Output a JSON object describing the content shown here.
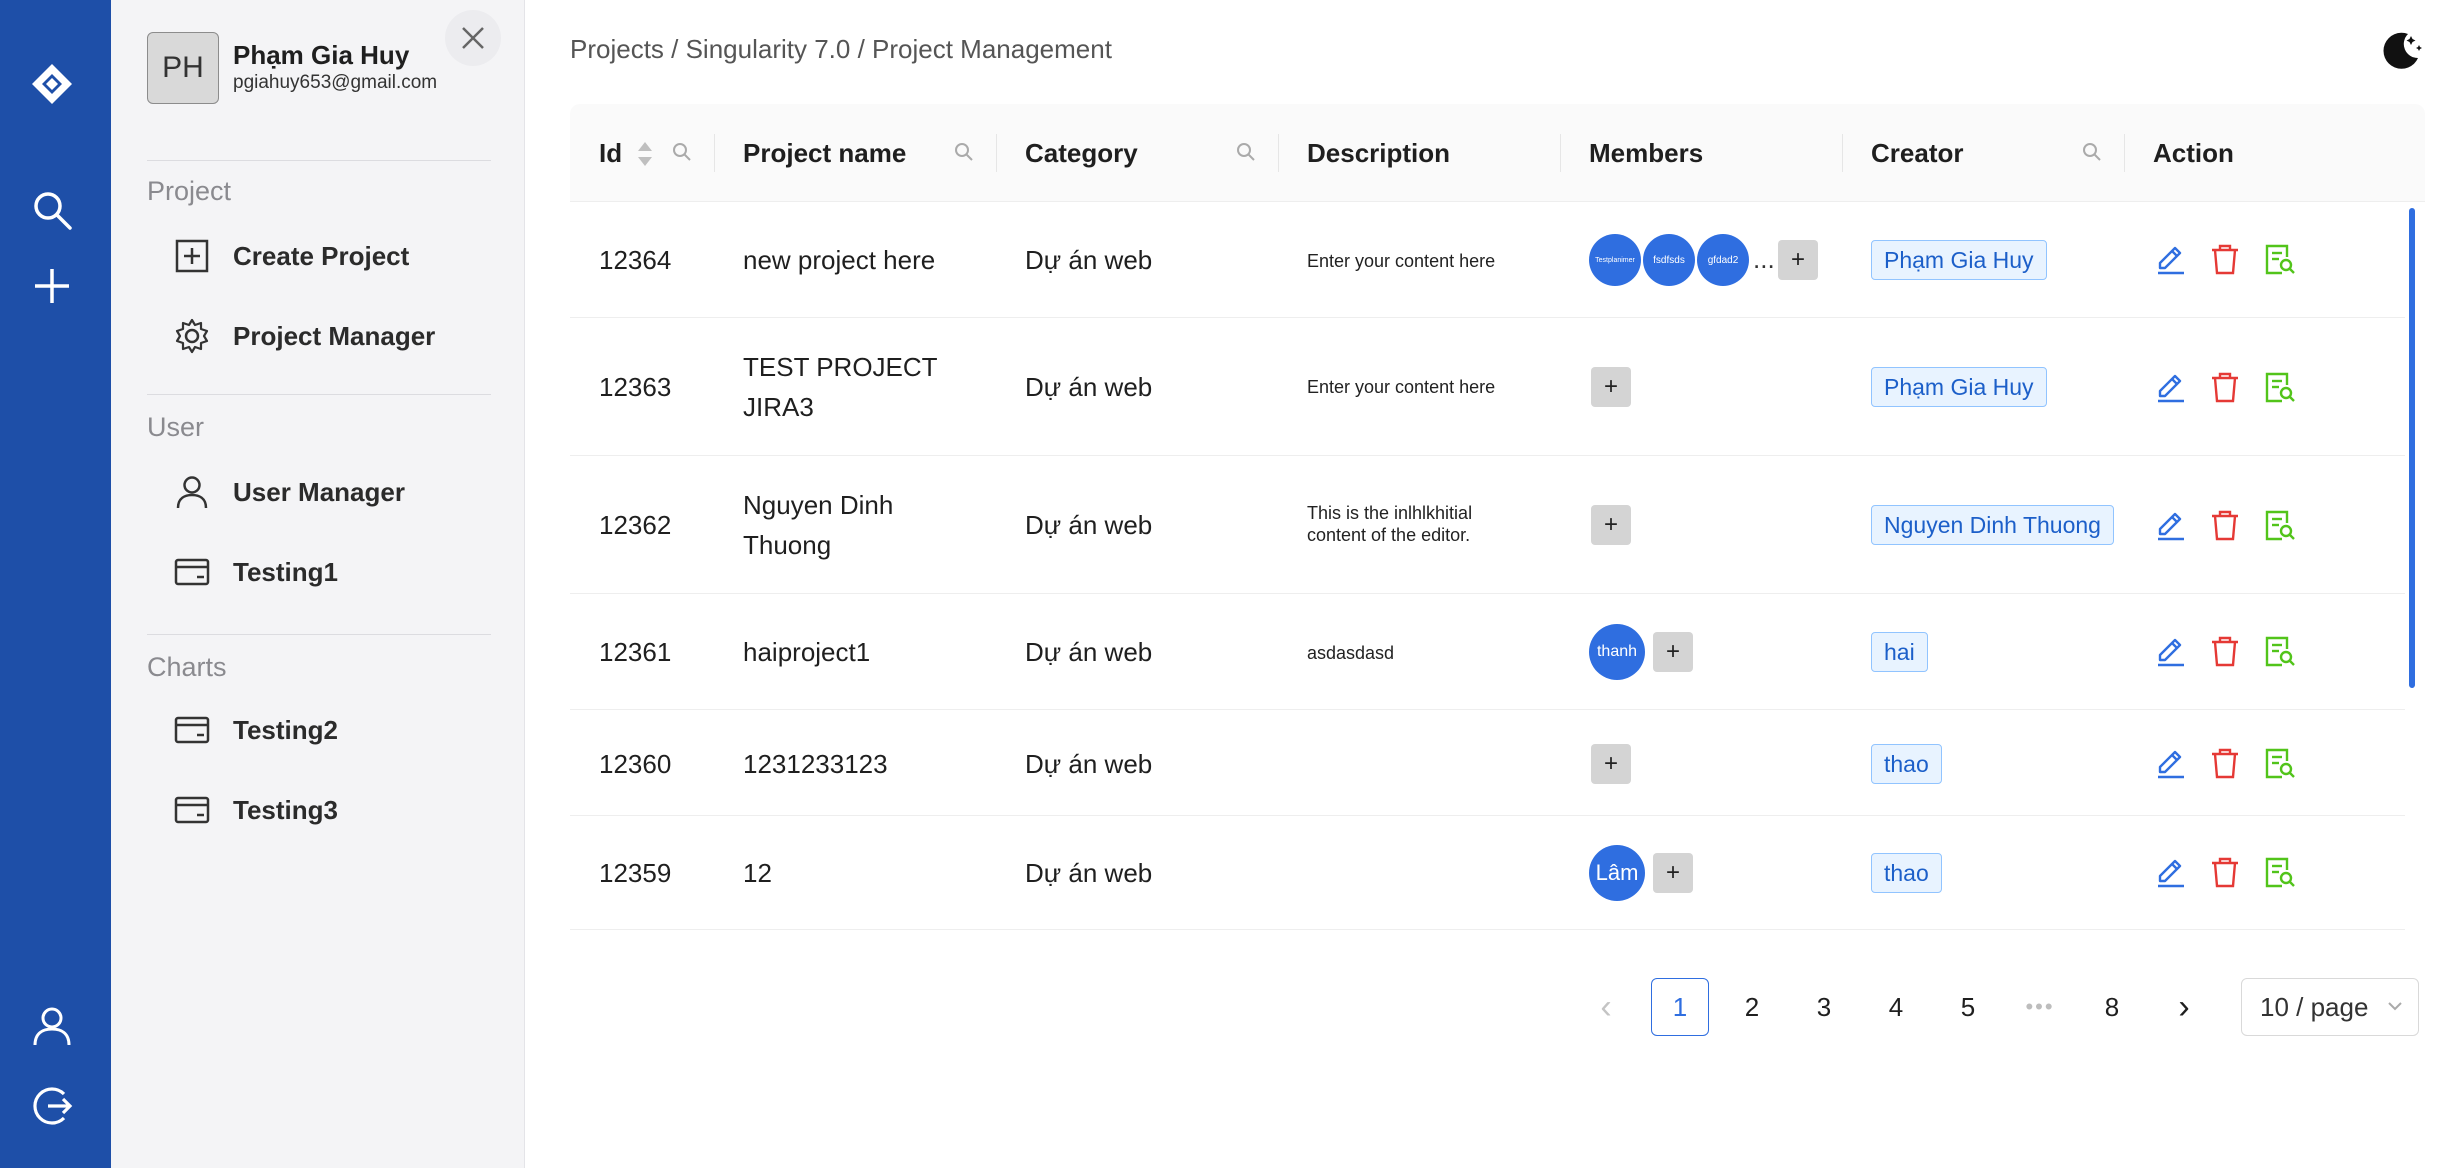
{
  "sidebar": {
    "user": {
      "initials": "PH",
      "name": "Phạm Gia Huy",
      "email": "pgiahuy653@gmail.com"
    },
    "sections": [
      {
        "title": "Project",
        "items": [
          {
            "label": "Create Project",
            "icon": "plus-square-icon"
          },
          {
            "label": "Project Manager",
            "icon": "gear-icon"
          }
        ]
      },
      {
        "title": "User",
        "items": [
          {
            "label": "User Manager",
            "icon": "user-icon"
          },
          {
            "label": "Testing1",
            "icon": "card-icon"
          }
        ]
      },
      {
        "title": "Charts",
        "items": [
          {
            "label": "Testing2",
            "icon": "card-icon"
          },
          {
            "label": "Testing3",
            "icon": "card-icon"
          }
        ]
      }
    ]
  },
  "rail": {
    "icons": [
      "logo-icon",
      "search-icon",
      "plus-icon",
      "user-icon",
      "logout-icon"
    ]
  },
  "header": {
    "breadcrumb": "Projects / Singularity 7.0 / Project Management",
    "theme_icon": "moon-icon"
  },
  "table": {
    "columns": [
      "Id",
      "Project name",
      "Category",
      "Description",
      "Members",
      "Creator",
      "Action"
    ],
    "rows": [
      {
        "id": "12364",
        "name": "new project here",
        "category": "Dự án web",
        "description": "Enter your content here",
        "members": [
          "Testplanimer",
          "fsdfsds",
          "gfdad2"
        ],
        "more": "...",
        "creator": "Phạm Gia Huy"
      },
      {
        "id": "12363",
        "name": "TEST PROJECT JIRA3",
        "category": "Dự án web",
        "description": "Enter your content here",
        "members": [],
        "creator": "Phạm Gia Huy"
      },
      {
        "id": "12362",
        "name": "Nguyen Dinh Thuong",
        "category": "Dự án web",
        "description": "This is the inlhlkhitial content of the editor.",
        "members": [],
        "creator": "Nguyen Dinh Thuong"
      },
      {
        "id": "12361",
        "name": "haiproject1",
        "category": "Dự án web",
        "description": "asdasdasd",
        "members": [
          "thanh"
        ],
        "creator": "hai"
      },
      {
        "id": "12360",
        "name": "1231233123",
        "category": "Dự án web",
        "description": "",
        "members": [],
        "creator": "thao"
      },
      {
        "id": "12359",
        "name": "12",
        "category": "Dự án web",
        "description": "",
        "members": [
          "Lâm"
        ],
        "creator": "thao"
      }
    ],
    "add_member_label": "+"
  },
  "pagination": {
    "prev": "‹",
    "pages": [
      "1",
      "2",
      "3",
      "4",
      "5"
    ],
    "jump": "•••",
    "last": "8",
    "next": "›",
    "current": "1",
    "page_size": "10 / page"
  },
  "colors": {
    "rail": "#1e4fa8",
    "accent": "#2f6ee0",
    "delete": "#e53935",
    "detail": "#52c41a"
  }
}
